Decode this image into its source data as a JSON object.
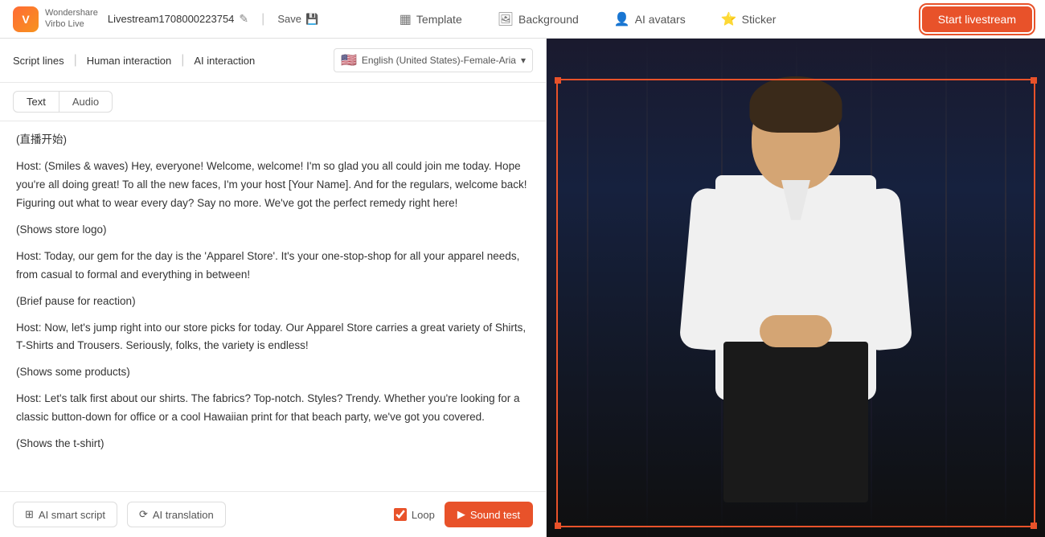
{
  "topbar": {
    "logo_line1": "Wondershare",
    "logo_line2": "Virbo Live",
    "stream_name": "Livestream1708000223754",
    "edit_icon": "✎",
    "save_label": "Save",
    "save_icon": "💾",
    "nav_items": [
      {
        "id": "template",
        "icon": "▦",
        "label": "Template"
      },
      {
        "id": "background",
        "icon": "🖼",
        "label": "Background"
      },
      {
        "id": "ai_avatars",
        "icon": "👤",
        "label": "AI avatars"
      },
      {
        "id": "sticker",
        "icon": "⭐",
        "label": "Sticker"
      }
    ],
    "start_button": "Start livestream"
  },
  "script_tabs": {
    "script_lines_label": "Script lines",
    "human_interaction_label": "Human interaction",
    "ai_interaction_label": "AI interaction",
    "language": "English (United States)-Female-Aria",
    "flag_emoji": "🇺🇸"
  },
  "content_tabs": {
    "text_label": "Text",
    "audio_label": "Audio"
  },
  "script_content": [
    {
      "id": "line1",
      "text": "(直播开始)"
    },
    {
      "id": "line2",
      "text": "Host: (Smiles & waves) Hey, everyone! Welcome, welcome! I'm so glad you all could join me today. Hope you're all doing great! To all the new faces, I'm your host [Your Name]. And for the regulars, welcome back! Figuring out what to wear every day? Say no more. We've got the perfect remedy right here!"
    },
    {
      "id": "line3",
      "text": "(Shows store logo)"
    },
    {
      "id": "line4",
      "text": "Host: Today, our gem for the day is the 'Apparel Store'. It's your one-stop-shop for all your apparel needs, from casual to formal and everything in between!"
    },
    {
      "id": "line5",
      "text": "(Brief pause for reaction)"
    },
    {
      "id": "line6",
      "text": "Host: Now, let's jump right into our store picks for today. Our Apparel Store carries a great variety of Shirts, T-Shirts and Trousers. Seriously, folks, the variety is endless!"
    },
    {
      "id": "line7",
      "text": "(Shows some products)"
    },
    {
      "id": "line8",
      "text": "Host: Let's talk first about our shirts. The fabrics? Top-notch. Styles? Trendy. Whether you're looking for a classic button-down for office or a cool Hawaiian print for that beach party, we've got you covered."
    },
    {
      "id": "line9",
      "text": "(Shows the t-shirt)"
    }
  ],
  "bottom_bar": {
    "ai_smart_script_label": "AI smart script",
    "ai_smart_script_icon": "⊞",
    "ai_translation_label": "AI translation",
    "ai_translation_icon": "⟳",
    "loop_label": "Loop",
    "sound_test_label": "Sound test",
    "sound_test_icon": "▶"
  }
}
